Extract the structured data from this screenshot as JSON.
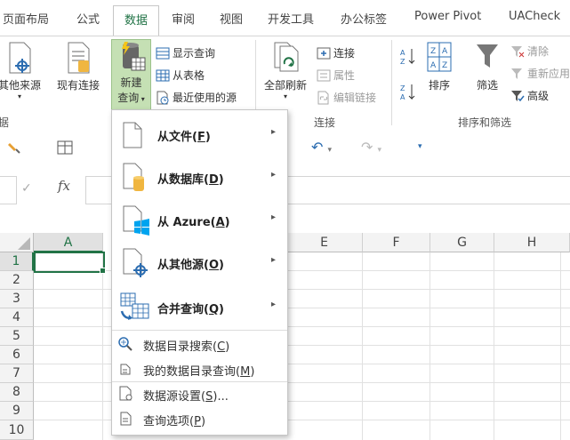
{
  "tabs": [
    {
      "label": "页面布局",
      "active": false
    },
    {
      "label": "公式",
      "active": false
    },
    {
      "label": "数据",
      "active": true
    },
    {
      "label": "审阅",
      "active": false
    },
    {
      "label": "视图",
      "active": false
    },
    {
      "label": "开发工具",
      "active": false
    },
    {
      "label": "办公标签",
      "active": false
    },
    {
      "label": "Power Pivot",
      "active": false
    },
    {
      "label": "UACheck",
      "active": false
    }
  ],
  "ribbon": {
    "other_sources": "其他来源",
    "existing_connection": "现有连接",
    "new_query_line1": "新建",
    "new_query_line2": "查询",
    "show_queries": "显示查询",
    "from_table": "从表格",
    "recent_sources": "最近使用的源",
    "refresh_all": "全部刷新",
    "connections": "连接",
    "properties": "属性",
    "edit_links": "编辑链接",
    "connections_group": "连接",
    "sort": "排序",
    "filter": "筛选",
    "clear": "清除",
    "reapply": "重新应用",
    "advanced": "高级",
    "sort_filter_group": "排序和筛选",
    "get_external_group_tail": "据"
  },
  "formula_bar": {
    "fx_label": "fx",
    "check": "✓"
  },
  "grid": {
    "columns": [
      "A",
      "E",
      "F",
      "G",
      "H"
    ],
    "rows": [
      "1",
      "2",
      "3",
      "4",
      "5",
      "6",
      "7",
      "8",
      "9",
      "10"
    ]
  },
  "menu": {
    "main_items": [
      {
        "label": "从文件",
        "key": "F"
      },
      {
        "label": "从数据库",
        "key": "D"
      },
      {
        "label": "从 Azure",
        "key": "A"
      },
      {
        "label": "从其他源",
        "key": "O"
      },
      {
        "label": "合并查询",
        "key": "Q"
      }
    ],
    "sub_items": [
      {
        "label": "数据目录搜索",
        "key": "C",
        "suffix": ""
      },
      {
        "label": "我的数据目录查询",
        "key": "M",
        "suffix": ""
      },
      {
        "label": "数据源设置",
        "key": "S",
        "suffix": "..."
      },
      {
        "label": "查询选项",
        "key": "P",
        "suffix": ""
      }
    ]
  },
  "colors": {
    "accent": "#217346",
    "highlight": "#c5e0b4",
    "selected_cell_border": "#217346"
  }
}
